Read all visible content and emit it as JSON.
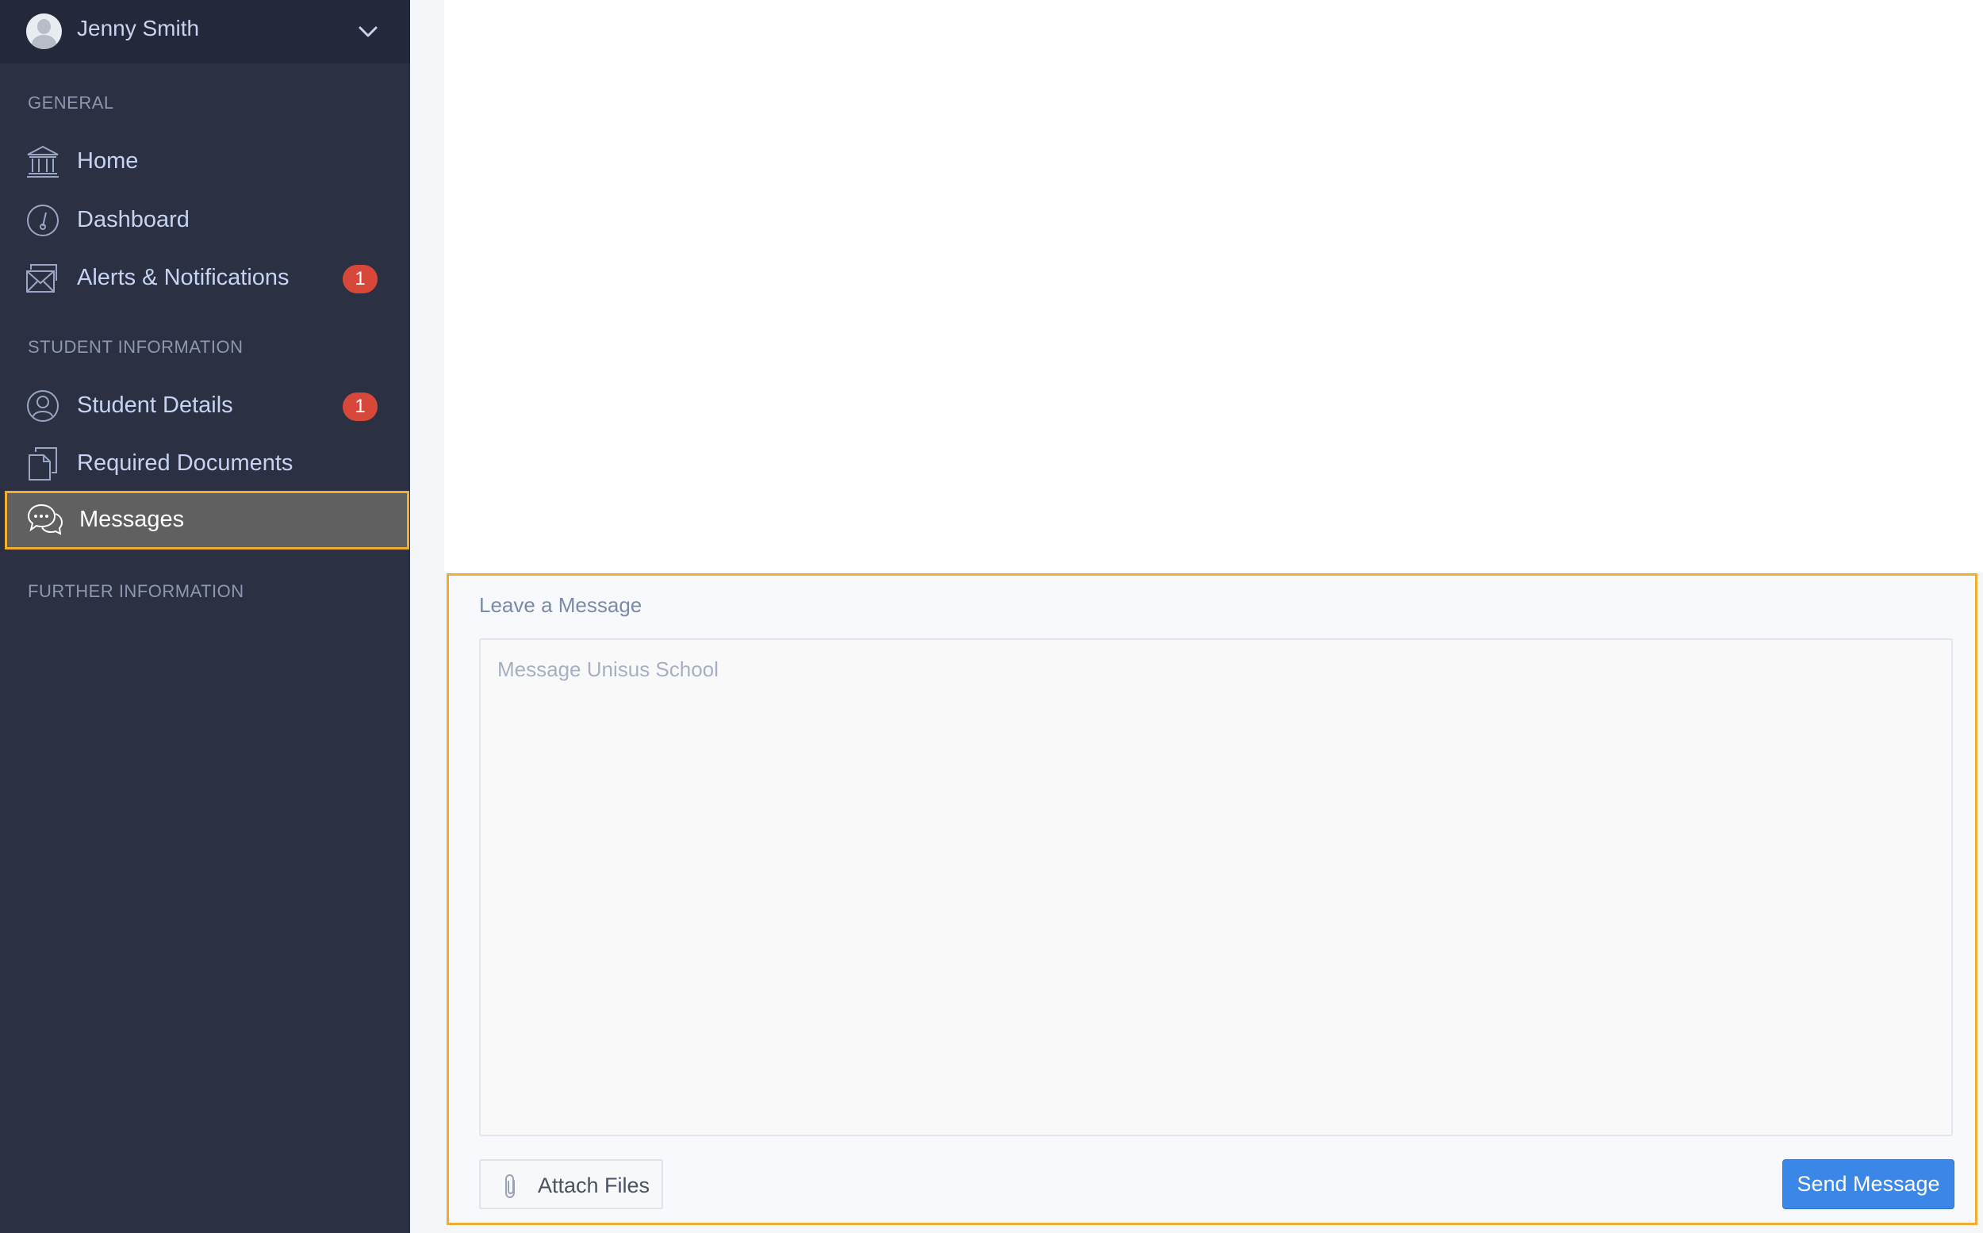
{
  "user": {
    "name": "Jenny Smith"
  },
  "sidebar": {
    "sections": [
      {
        "title": "GENERAL"
      },
      {
        "title": "STUDENT INFORMATION"
      },
      {
        "title": "FURTHER INFORMATION"
      }
    ],
    "items": [
      {
        "label": "Home",
        "icon": "bank-icon"
      },
      {
        "label": "Dashboard",
        "icon": "gauge-icon"
      },
      {
        "label": "Alerts & Notifications",
        "icon": "envelope-icon",
        "badge": "1"
      },
      {
        "label": "Student Details",
        "icon": "user-circle-icon",
        "badge": "1"
      },
      {
        "label": "Required Documents",
        "icon": "documents-icon"
      },
      {
        "label": "Messages",
        "icon": "chat-bubbles-icon",
        "active": true
      }
    ]
  },
  "compose": {
    "title": "Leave a Message",
    "placeholder": "Message Unisus School",
    "value": "",
    "attach_label": "Attach Files",
    "send_label": "Send Message"
  },
  "colors": {
    "sidebar_bg": "#2b3142",
    "user_bar_bg": "#23283a",
    "active_item_bg": "#606060",
    "highlight_border": "#f0ad2e",
    "badge": "#d8483a",
    "send_button": "#3a87e8"
  }
}
